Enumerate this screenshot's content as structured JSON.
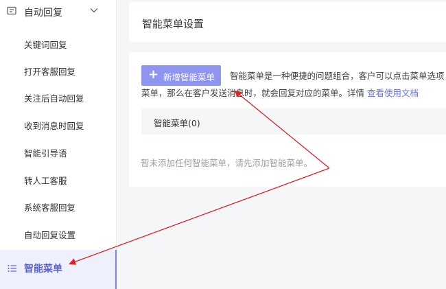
{
  "sidebar": {
    "group_label": "自动回复",
    "items": [
      {
        "label": "关键词回复"
      },
      {
        "label": "打开客服回复"
      },
      {
        "label": "关注后自动回复"
      },
      {
        "label": "收到消息时回复"
      },
      {
        "label": "智能引导语"
      },
      {
        "label": "转人工客服"
      },
      {
        "label": "系统客服回复"
      },
      {
        "label": "自动回复设置"
      }
    ],
    "active_label": "智能菜单"
  },
  "header": {
    "title": "智能菜单设置"
  },
  "content": {
    "add_button_label": "新增智能菜单",
    "description_line1": "智能菜单是一种便捷的问题组合，客户可以点击菜单选项，",
    "description_line2": "菜单，那么在客户发送消息时，就会回复对应的菜单。详情",
    "doc_link": "查看使用文档",
    "table_header": "智能菜单(0)",
    "empty_text": "暂未添加任何智能菜单，请先添加智能菜单。"
  },
  "colors": {
    "accent": "#8d95f0",
    "active_text": "#5a63d8",
    "annotation_arrow": "#e02020"
  }
}
